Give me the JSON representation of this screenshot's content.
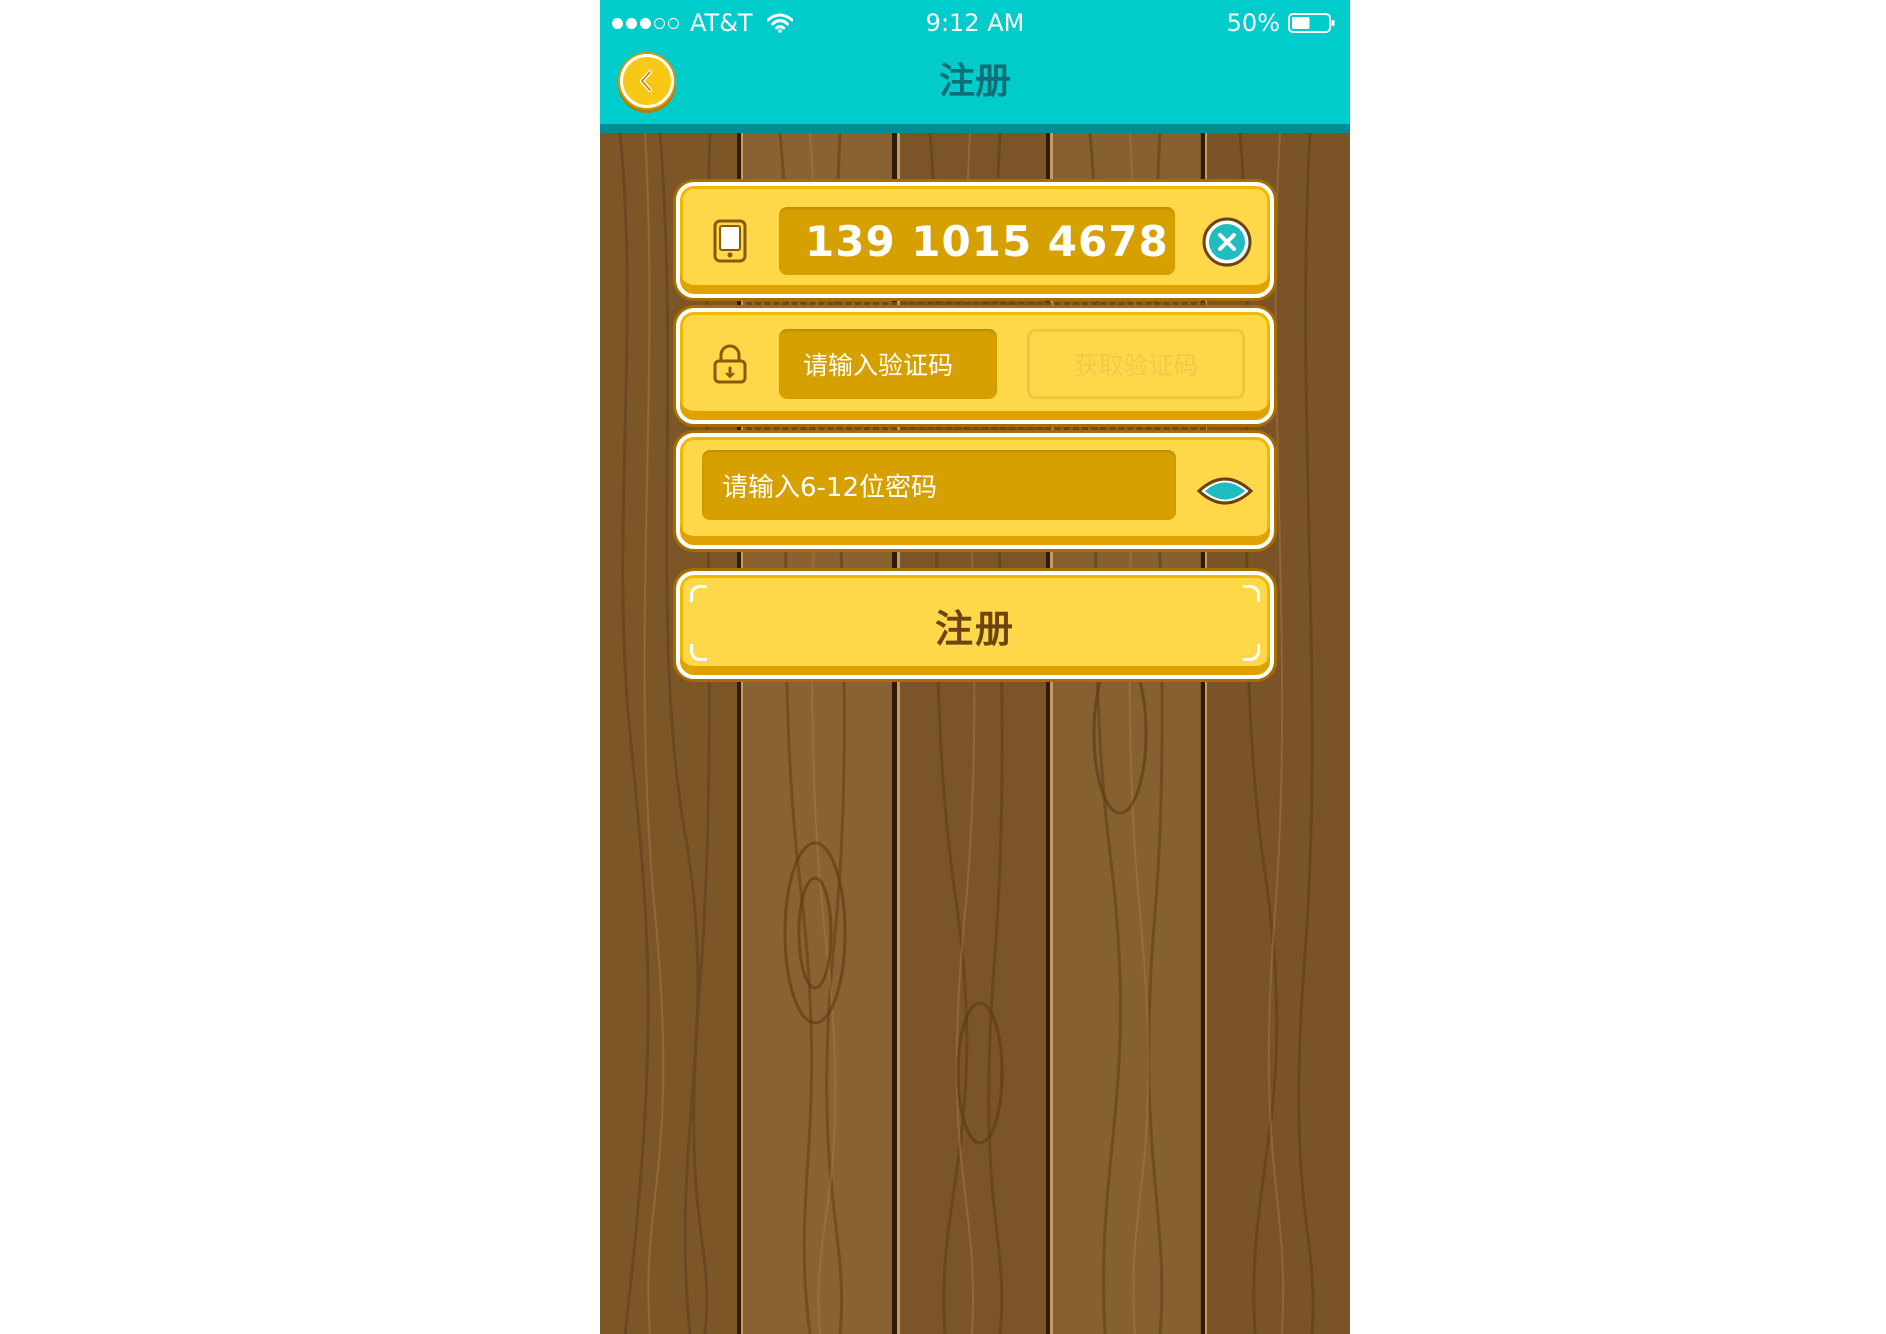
{
  "status_bar": {
    "carrier": "AT&T",
    "time": "9:12 AM",
    "battery_percent": "50%",
    "battery_level": 0.5,
    "signal_bars": 3,
    "signal_total": 5
  },
  "nav": {
    "title": "注册",
    "back_icon": "chevron-left-icon"
  },
  "form": {
    "phone": {
      "icon": "phone-icon",
      "value": "139 1015 4678",
      "clear_icon": "close-icon"
    },
    "code": {
      "icon": "lock-icon",
      "placeholder": "请输入验证码",
      "get_code_label": "获取验证码"
    },
    "password": {
      "placeholder": "请输入6-12位密码",
      "toggle_icon": "eye-icon"
    },
    "submit_label": "注册"
  },
  "colors": {
    "nav_bg": "#00cccc",
    "nav_title": "#0e6e73",
    "panel_yellow": "#ffd84a",
    "field_gold": "#d6a000",
    "wood": "#7a5326",
    "accent_teal": "#1fbcc0"
  }
}
